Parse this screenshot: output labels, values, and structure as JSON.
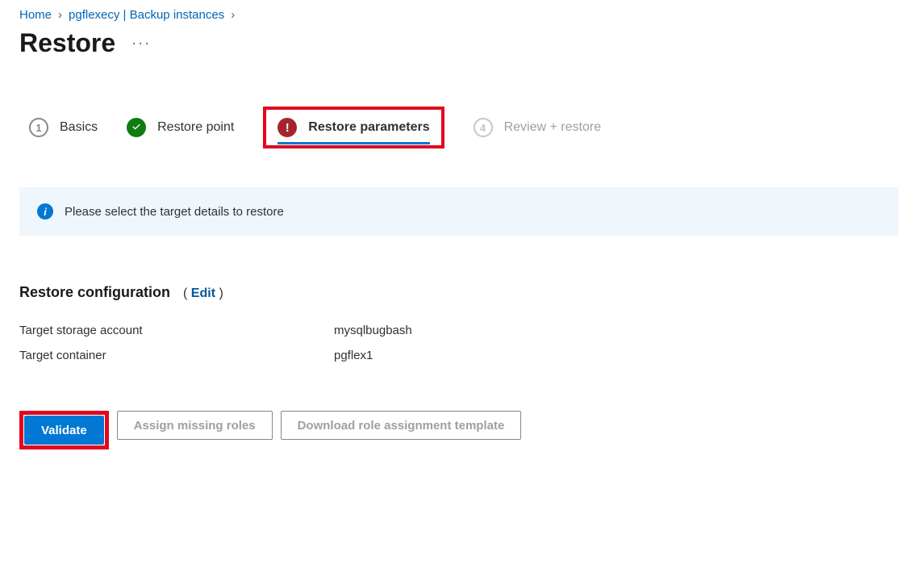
{
  "breadcrumb": {
    "home": "Home",
    "item1": "pgflexecy | Backup instances"
  },
  "page": {
    "title": "Restore",
    "ellipsis": "···"
  },
  "steps": {
    "s1_num": "1",
    "s1_label": "Basics",
    "s2_label": "Restore point",
    "s3_label": "Restore parameters",
    "s4_num": "4",
    "s4_label": "Review + restore"
  },
  "banner": {
    "icon": "i",
    "text": "Please select the target details to restore"
  },
  "config": {
    "title": "Restore configuration",
    "edit_label": "Edit",
    "rows": [
      {
        "key": "Target storage account",
        "val": "mysqlbugbash"
      },
      {
        "key": "Target container",
        "val": "pgflex1"
      }
    ]
  },
  "actions": {
    "validate": "Validate",
    "assign": "Assign missing roles",
    "download": "Download role assignment template"
  }
}
